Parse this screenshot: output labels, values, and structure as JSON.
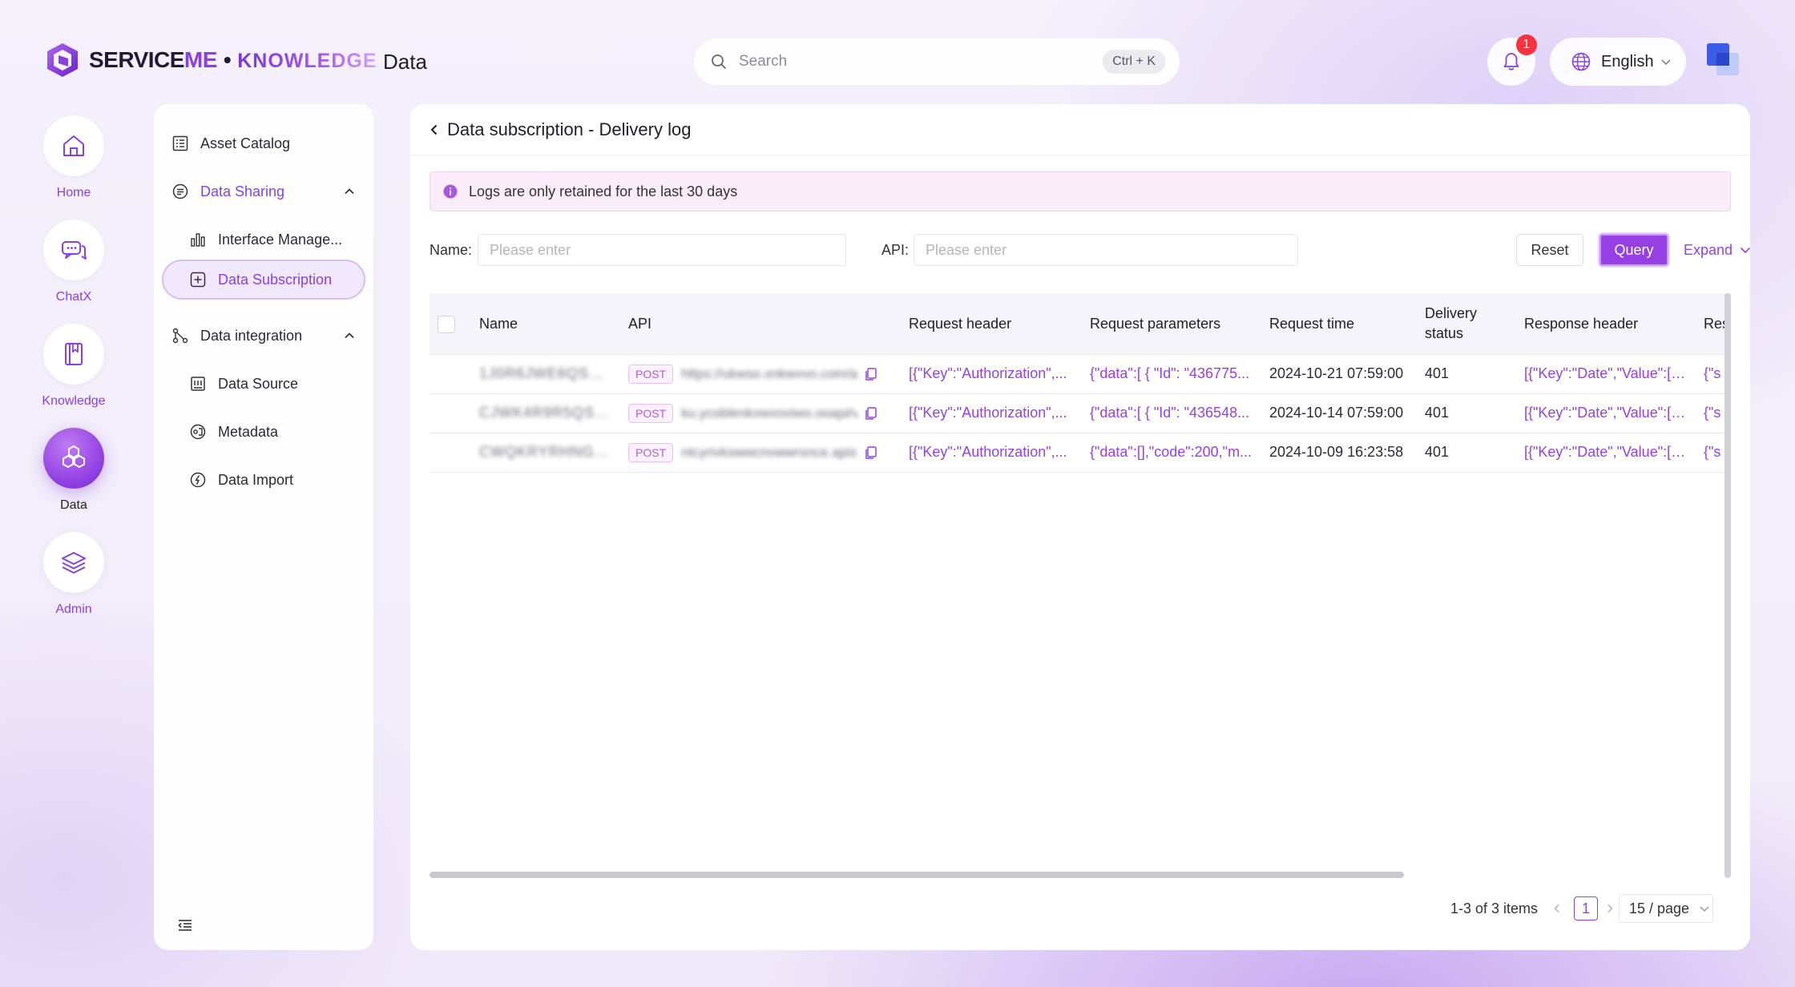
{
  "brand": {
    "name_part1": "SERVICE",
    "name_part2": "ME",
    "separator": "•",
    "product": "KNOWLEDGE",
    "module": "Data",
    "accent_color": "#9640e4"
  },
  "header": {
    "search_placeholder": "Search",
    "search_shortcut": "Ctrl + K",
    "notification_count": "1",
    "language": "English"
  },
  "rail": {
    "items": [
      {
        "label": "Home",
        "icon": "home-icon"
      },
      {
        "label": "ChatX",
        "icon": "chat-icon"
      },
      {
        "label": "Knowledge",
        "icon": "book-icon"
      },
      {
        "label": "Data",
        "icon": "hexagons-icon",
        "active": true
      },
      {
        "label": "Admin",
        "icon": "layers-icon"
      }
    ]
  },
  "subnav": {
    "items": [
      {
        "label": "Asset Catalog",
        "icon": "list-icon"
      },
      {
        "label": "Data Sharing",
        "icon": "sharing-icon",
        "expanded": true
      },
      {
        "label": "Interface Manage...",
        "icon": "bar-chart-icon"
      },
      {
        "label": "Data Subscription",
        "icon": "plus-square-icon",
        "selected": true
      },
      {
        "label": "Data integration",
        "icon": "nodes-icon",
        "expanded": true
      },
      {
        "label": "Data Source",
        "icon": "database-icon"
      },
      {
        "label": "Metadata",
        "icon": "metadata-icon"
      },
      {
        "label": "Data Import",
        "icon": "import-icon"
      }
    ]
  },
  "page": {
    "title": "Data subscription - Delivery log",
    "notice": "Logs are only retained for the last 30 days"
  },
  "filters": {
    "name_label": "Name:",
    "name_placeholder": "Please enter",
    "api_label": "API:",
    "api_placeholder": "Please enter",
    "reset_label": "Reset",
    "query_label": "Query",
    "expand_label": "Expand"
  },
  "table": {
    "columns": [
      "Name",
      "API",
      "Request header",
      "Request parameters",
      "Request time",
      "Delivery status",
      "Response header",
      "Res"
    ],
    "rows": [
      {
        "name": "1J0R6JWE6QSQBL",
        "method": "POST",
        "api": "https://ukwso.xnkwvvo.com/api/sub/v1/delivery",
        "request_header": "[{\"Key\":\"Authorization\",...",
        "request_parameters": "{\"data\":[ { \"Id\": \"436775...",
        "request_time": "2024-10-21 07:59:00",
        "delivery_status": "401",
        "response_header": "[{\"Key\":\"Date\",\"Value\":[\"...",
        "response_body": "{\"s"
      },
      {
        "name": "CJWK4R9R5QSNL",
        "method": "POST",
        "api": "ku.ycoblenkvwvoviwo.ooapi/vsub/delivery",
        "request_header": "[{\"Key\":\"Authorization\",...",
        "request_parameters": "{\"data\":[ { \"Id\": \"436548...",
        "request_time": "2024-10-14 07:59:00",
        "delivery_status": "401",
        "response_header": "[{\"Key\":\"Date\",\"Value\":[\"...",
        "response_body": "{\"s"
      },
      {
        "name": "CWQKRYRHNGSJL",
        "method": "POST",
        "api": "ntcyrivkswwcnvwwrsnce.apisub/delivery",
        "request_header": "[{\"Key\":\"Authorization\",...",
        "request_parameters": "{\"data\":[],\"code\":200,\"m...",
        "request_time": "2024-10-09 16:23:58",
        "delivery_status": "401",
        "response_header": "[{\"Key\":\"Date\",\"Value\":[\"...",
        "response_body": "{\"s"
      }
    ]
  },
  "pagination": {
    "total": "1-3 of 3 items",
    "current_page": "1",
    "page_size": "15 / page"
  }
}
